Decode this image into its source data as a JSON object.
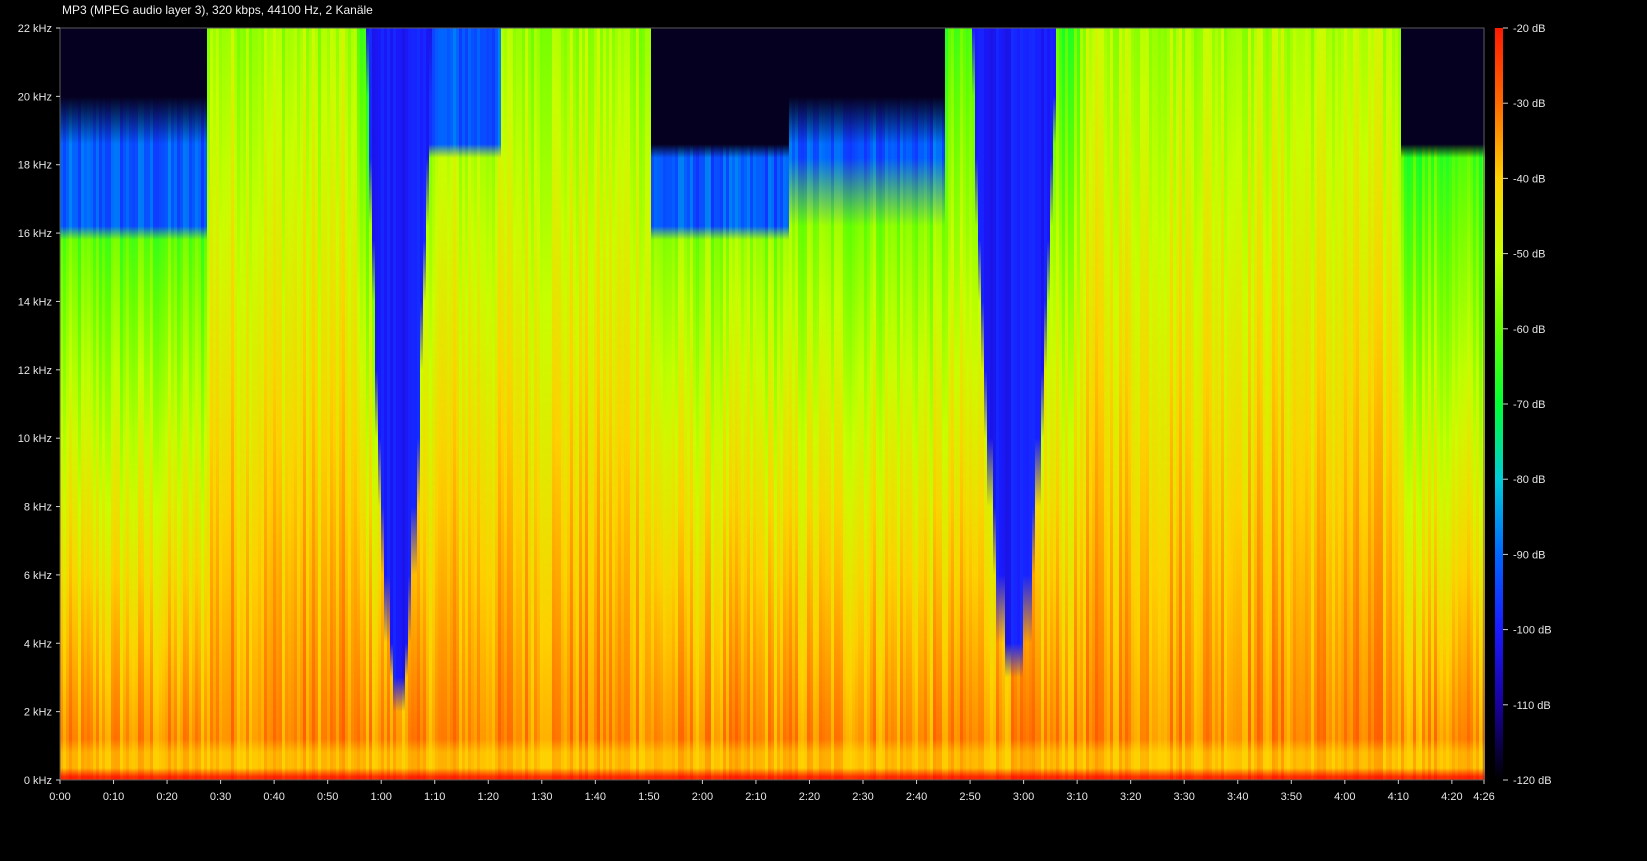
{
  "header": {
    "title": "MP3 (MPEG audio layer 3), 320 kbps, 44100 Hz, 2 Kanäle"
  },
  "chart_data": {
    "type": "heatmap",
    "title": "MP3 (MPEG audio layer 3), 320 kbps, 44100 Hz, 2 Kanäle",
    "xlabel": "",
    "ylabel": "",
    "x_unit": "time (m:ss)",
    "y_unit": "kHz",
    "xlim_seconds": [
      0,
      266
    ],
    "ylim_khz": [
      0,
      22
    ],
    "x_ticks": [
      {
        "s": 0,
        "label": "0:00"
      },
      {
        "s": 10,
        "label": "0:10"
      },
      {
        "s": 20,
        "label": "0:20"
      },
      {
        "s": 30,
        "label": "0:30"
      },
      {
        "s": 40,
        "label": "0:40"
      },
      {
        "s": 50,
        "label": "0:50"
      },
      {
        "s": 60,
        "label": "1:00"
      },
      {
        "s": 70,
        "label": "1:10"
      },
      {
        "s": 80,
        "label": "1:20"
      },
      {
        "s": 90,
        "label": "1:30"
      },
      {
        "s": 100,
        "label": "1:40"
      },
      {
        "s": 110,
        "label": "1:50"
      },
      {
        "s": 120,
        "label": "2:00"
      },
      {
        "s": 130,
        "label": "2:10"
      },
      {
        "s": 140,
        "label": "2:20"
      },
      {
        "s": 150,
        "label": "2:30"
      },
      {
        "s": 160,
        "label": "2:40"
      },
      {
        "s": 170,
        "label": "2:50"
      },
      {
        "s": 180,
        "label": "3:00"
      },
      {
        "s": 190,
        "label": "3:10"
      },
      {
        "s": 200,
        "label": "3:20"
      },
      {
        "s": 210,
        "label": "3:30"
      },
      {
        "s": 220,
        "label": "3:40"
      },
      {
        "s": 230,
        "label": "3:50"
      },
      {
        "s": 240,
        "label": "4:00"
      },
      {
        "s": 250,
        "label": "4:10"
      },
      {
        "s": 260,
        "label": "4:20"
      },
      {
        "s": 266,
        "label": "4:26"
      }
    ],
    "y_ticks": [
      {
        "khz": 0,
        "label": "0 kHz"
      },
      {
        "khz": 2,
        "label": "2 kHz"
      },
      {
        "khz": 4,
        "label": "4 kHz"
      },
      {
        "khz": 6,
        "label": "6 kHz"
      },
      {
        "khz": 8,
        "label": "8 kHz"
      },
      {
        "khz": 10,
        "label": "10 kHz"
      },
      {
        "khz": 12,
        "label": "12 kHz"
      },
      {
        "khz": 14,
        "label": "14 kHz"
      },
      {
        "khz": 16,
        "label": "16 kHz"
      },
      {
        "khz": 18,
        "label": "18 kHz"
      },
      {
        "khz": 20,
        "label": "20 kHz"
      },
      {
        "khz": 22,
        "label": "22 kHz"
      }
    ],
    "colorbar": {
      "range_db": [
        -120,
        -20
      ],
      "ticks": [
        {
          "db": -20,
          "label": "-20 dB"
        },
        {
          "db": -30,
          "label": "-30 dB"
        },
        {
          "db": -40,
          "label": "-40 dB"
        },
        {
          "db": -50,
          "label": "-50 dB"
        },
        {
          "db": -60,
          "label": "-60 dB"
        },
        {
          "db": -70,
          "label": "-70 dB"
        },
        {
          "db": -80,
          "label": "-80 dB"
        },
        {
          "db": -90,
          "label": "-90 dB"
        },
        {
          "db": -100,
          "label": "-100 dB"
        },
        {
          "db": -110,
          "label": "-110 dB"
        },
        {
          "db": -120,
          "label": "-120 dB"
        }
      ],
      "stops": [
        {
          "db": -20,
          "color": "#ff1a00"
        },
        {
          "db": -30,
          "color": "#ff6a00"
        },
        {
          "db": -40,
          "color": "#ffd000"
        },
        {
          "db": -50,
          "color": "#c8ff00"
        },
        {
          "db": -60,
          "color": "#66ff00"
        },
        {
          "db": -70,
          "color": "#00ff33"
        },
        {
          "db": -80,
          "color": "#00ccd9"
        },
        {
          "db": -90,
          "color": "#0066ff"
        },
        {
          "db": -100,
          "color": "#1a1aff"
        },
        {
          "db": -110,
          "color": "#18009a"
        },
        {
          "db": -120,
          "color": "#000000"
        }
      ]
    },
    "segments": [
      {
        "t0": 0,
        "t1": 27,
        "cutoff_khz": 16.0,
        "spill_khz": 18.6,
        "energy": 0.4
      },
      {
        "t0": 27,
        "t1": 55,
        "cutoff_khz": 22.0,
        "spill_khz": 22.0,
        "energy": 0.8
      },
      {
        "t0": 55,
        "t1": 68,
        "cutoff_khz": 22.0,
        "spill_khz": 22.0,
        "energy": 0.55
      },
      {
        "t0": 68,
        "t1": 82,
        "cutoff_khz": 18.5,
        "spill_khz": 22.0,
        "energy": 0.75
      },
      {
        "t0": 82,
        "t1": 110,
        "cutoff_khz": 22.0,
        "spill_khz": 22.0,
        "energy": 0.78
      },
      {
        "t0": 110,
        "t1": 136,
        "cutoff_khz": 16.0,
        "spill_khz": 18.3,
        "energy": 0.55
      },
      {
        "t0": 136,
        "t1": 165,
        "cutoff_khz": 17.8,
        "spill_khz": 18.6,
        "energy": 0.55
      },
      {
        "t0": 165,
        "t1": 190,
        "cutoff_khz": 22.0,
        "spill_khz": 22.0,
        "energy": 0.6
      },
      {
        "t0": 190,
        "t1": 250,
        "cutoff_khz": 22.0,
        "spill_khz": 22.0,
        "energy": 0.82
      },
      {
        "t0": 250,
        "t1": 266,
        "cutoff_khz": 18.3,
        "spill_khz": 18.3,
        "energy": 0.45
      }
    ],
    "dark_funnels": [
      {
        "center_s": 63,
        "top_half_width_s": 6,
        "apex_khz": 2.5,
        "dark_above_khz": 6
      },
      {
        "center_s": 178,
        "top_half_width_s": 8,
        "apex_khz": 3.0,
        "dark_above_khz": 5
      }
    ],
    "grid": false,
    "legend": "colorbar-right"
  }
}
